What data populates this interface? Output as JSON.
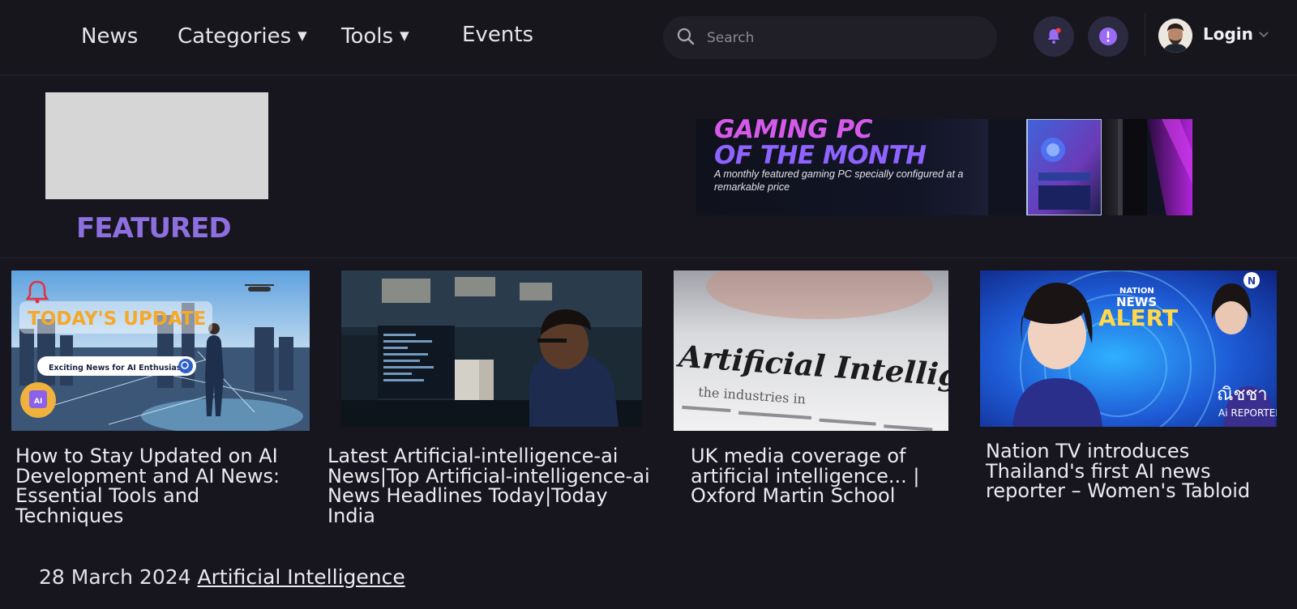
{
  "nav": {
    "items": [
      {
        "label": "News"
      },
      {
        "label": "Categories",
        "caret": "▼"
      },
      {
        "label": "Tools",
        "caret": "▼"
      },
      {
        "label": "Events"
      }
    ]
  },
  "search": {
    "placeholder": "Search"
  },
  "user": {
    "login_label": "Login"
  },
  "featured": {
    "label": "FEATURED"
  },
  "banner": {
    "title_line1": "GAMING PC",
    "title_line2": "OF THE MONTH",
    "subtitle": "A monthly featured gaming PC specially configured at a remarkable price"
  },
  "articles": [
    {
      "title": "How to Stay Updated on AI Development and AI News: Essential Tools and Techniques",
      "image_text": {
        "headline": "TODAY'S UPDATE",
        "pill": "Exciting News for AI Enthusiasts!",
        "badge": "AI"
      }
    },
    {
      "title": "Latest Artificial-intelligence-ai News|Top Artificial-intelligence-ai News Headlines Today|Today India"
    },
    {
      "title": "UK media coverage of artificial intelligence... | Oxford Martin School",
      "image_text": {
        "headline": "Artificial Intelligence",
        "body": "the industries in"
      }
    },
    {
      "title": "Nation TV introduces Thailand's first AI news reporter – Women's Tabloid",
      "image_text": {
        "brand": "NATION",
        "news": "NEWS",
        "alert": "ALERT",
        "name": "ณิชชา",
        "role": "Ai REPORTER",
        "logo": "N"
      }
    }
  ],
  "meta": {
    "date": "28 March 2024",
    "category": "Artificial Intelligence"
  },
  "colors": {
    "accent": "#8e6fe0",
    "background": "#17151d"
  }
}
